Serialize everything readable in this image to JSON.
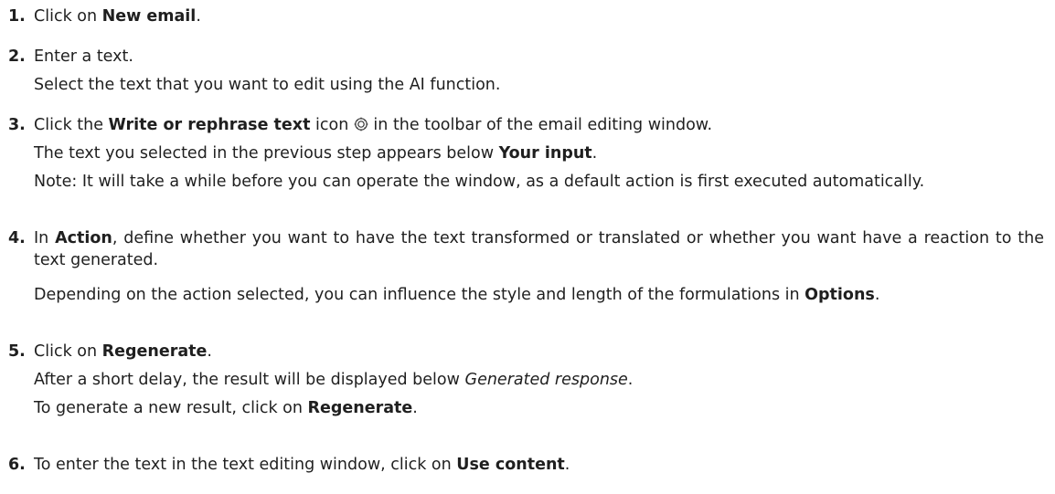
{
  "steps": [
    {
      "num": "1.",
      "lines": [
        {
          "pre": "Click on ",
          "b1": "New email",
          "post": "."
        }
      ]
    },
    {
      "num": "2.",
      "lines": [
        {
          "text": "Enter a text."
        },
        {
          "text": "Select the text that you want to edit using the AI function."
        }
      ]
    },
    {
      "num": "3.",
      "lines": [
        {
          "pre": "Click the ",
          "b1": "Write or rephrase text",
          "mid": " icon ",
          "icon": "ai-sparkle-icon",
          "post": " in the toolbar of the email editing window."
        },
        {
          "pre": "The text you selected in the previous step appears below ",
          "b1": "Your input",
          "post": "."
        },
        {
          "text": "Note: It will take a while before you can operate the window, as a default action is first executed automatically."
        }
      ]
    },
    {
      "num": "4.",
      "lines": [
        {
          "pre": "In ",
          "b1": "Action",
          "post": ", define whether you want to have the text transformed or translated or whether you want have a reaction to the text generated."
        },
        {
          "pre": "Depending on the action selected, you can influence the style and length of the formulations in ",
          "b1": "Options",
          "post": "."
        }
      ]
    },
    {
      "num": "5.",
      "lines": [
        {
          "pre": "Click on ",
          "b1": "Regenerate",
          "post": "."
        },
        {
          "pre": "After a short delay, the result will be displayed below ",
          "i1": "Generated response",
          "post": "."
        },
        {
          "pre": "To generate a new result, click on ",
          "b1": "Regenerate",
          "post": "."
        }
      ]
    },
    {
      "num": "6.",
      "lines": [
        {
          "pre": "To enter the text in the text editing window, click on ",
          "b1": "Use content",
          "post": "."
        }
      ]
    }
  ]
}
